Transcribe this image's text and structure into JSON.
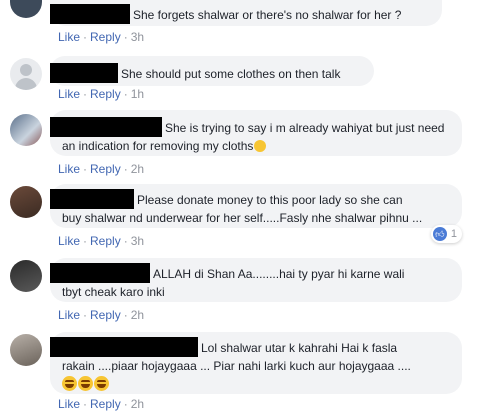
{
  "comments": [
    {
      "text": "She forgets shalwar or there's no shalwar for her ?",
      "actions": {
        "like": "Like",
        "reply": "Reply",
        "sep": "·",
        "time": "3h"
      }
    },
    {
      "text": "She should put some clothes on then talk",
      "actions": {
        "like": "Like",
        "reply": "Reply",
        "sep": "·",
        "time": "1h"
      }
    },
    {
      "line1": "She is trying to say i m already wahiyat but just need",
      "line2": "an indication for removing my cloths",
      "actions": {
        "like": "Like",
        "reply": "Reply",
        "sep": "·",
        "time": "2h"
      }
    },
    {
      "line1": "Please donate money to this poor lady so she can",
      "line2": "buy shalwar nd underwear for her self.....Fasly nhe shalwar pihnu ...",
      "reaction_count": "1",
      "actions": {
        "like": "Like",
        "reply": "Reply",
        "sep": "·",
        "time": "3h"
      }
    },
    {
      "line1": "ALLAH di Shan Aa........hai ty pyar hi karne wali",
      "line2": "tbyt cheak karo inki",
      "actions": {
        "like": "Like",
        "reply": "Reply",
        "sep": "·",
        "time": "2h"
      }
    },
    {
      "line1": "Lol shalwar utar k kahrahi Hai k fasla",
      "line2": "rakain ....piaar hojaygaaa ... Piar nahi larki kuch aur hojaygaaa ....",
      "actions": {
        "like": "Like",
        "reply": "Reply",
        "sep": "·",
        "time": "2h"
      }
    }
  ],
  "icons": {
    "like_reaction": "thumbs-up-icon",
    "emoji": "grinning-sweat-emoji-icon",
    "inline_emoji": "smiling-emoji-icon"
  }
}
